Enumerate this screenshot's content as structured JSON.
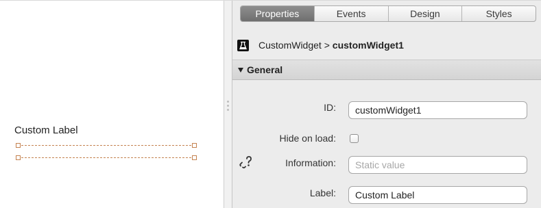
{
  "canvas": {
    "widget_label": "Custom Label"
  },
  "panel": {
    "tabs": [
      {
        "label": "Properties",
        "active": true
      },
      {
        "label": "Events",
        "active": false
      },
      {
        "label": "Design",
        "active": false
      },
      {
        "label": "Styles",
        "active": false
      }
    ],
    "breadcrumb": {
      "icon": "flask-icon",
      "parent": "CustomWidget",
      "separator": ">",
      "current": "customWidget1"
    },
    "section": {
      "title": "General",
      "expanded": true
    },
    "fields": {
      "id": {
        "label": "ID:",
        "value": "customWidget1"
      },
      "hide_on_load": {
        "label": "Hide on load:",
        "checked": false
      },
      "information": {
        "label": "Information:",
        "value": "",
        "placeholder": "Static value",
        "icon": "unlink-icon"
      },
      "label": {
        "label": "Label:",
        "value": "Custom Label"
      }
    }
  },
  "colors": {
    "selection": "#c4814e",
    "active_tab": "#7d7d7d",
    "panel_bg": "#ececec"
  }
}
